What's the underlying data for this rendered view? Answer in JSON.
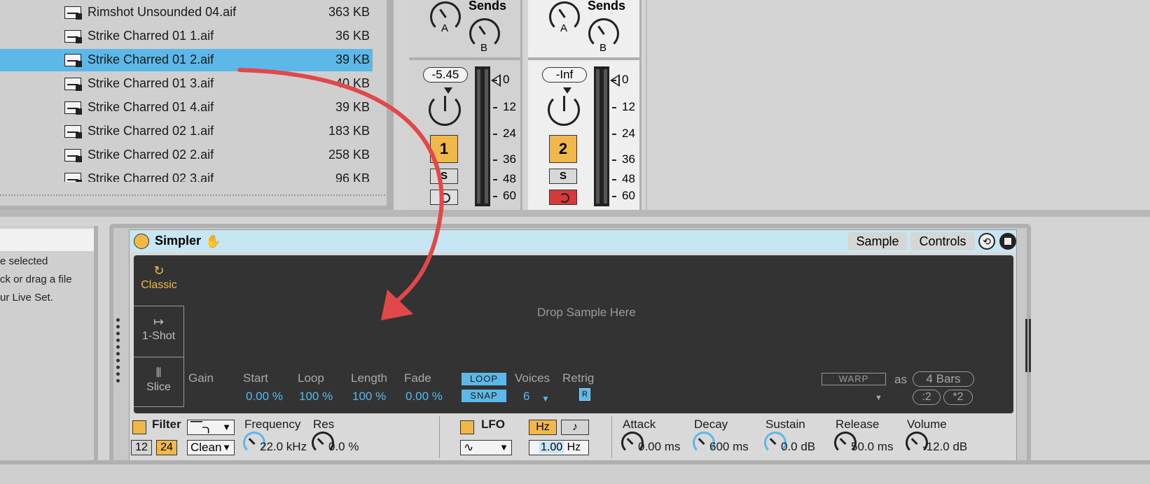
{
  "browser": {
    "files": [
      {
        "name": "Rimshot Unsounded 04.aif",
        "size": "363 KB"
      },
      {
        "name": "Strike Charred 01 1.aif",
        "size": "36 KB"
      },
      {
        "name": "Strike Charred 01 2.aif",
        "size": "39 KB"
      },
      {
        "name": "Strike Charred 01 3.aif",
        "size": "40 KB"
      },
      {
        "name": "Strike Charred 01 4.aif",
        "size": "39 KB"
      },
      {
        "name": "Strike Charred 02 1.aif",
        "size": "183 KB"
      },
      {
        "name": "Strike Charred 02 2.aif",
        "size": "258 KB"
      },
      {
        "name": "Strike Charred 02 3.aif",
        "size": "96 KB"
      }
    ],
    "selected_index": 2
  },
  "mixer": {
    "sends_label": "Sends",
    "send_a": "A",
    "send_b": "B",
    "tracks": [
      {
        "volume": "-5.45",
        "number": "1",
        "solo": "S",
        "armed": false
      },
      {
        "volume": "-Inf",
        "number": "2",
        "solo": "S",
        "armed": true
      }
    ],
    "scale": [
      "0",
      "12",
      "24",
      "36",
      "48",
      "60"
    ]
  },
  "info": {
    "lines": [
      "e selected",
      "ck or drag a file",
      "ur Live Set."
    ]
  },
  "simpler": {
    "title": "Simpler",
    "tab_sample": "Sample",
    "tab_controls": "Controls",
    "modes": [
      {
        "label": "Classic",
        "icon": "loop-arrow-icon"
      },
      {
        "label": "1-Shot",
        "icon": "one-shot-arrow-icon"
      },
      {
        "label": "Slice",
        "icon": "slice-bars-icon"
      }
    ],
    "drop_text": "Drop Sample Here",
    "params": {
      "gain": {
        "label": "Gain"
      },
      "start": {
        "label": "Start",
        "value": "0.00 %"
      },
      "loop": {
        "label": "Loop",
        "value": "100 %"
      },
      "length": {
        "label": "Length",
        "value": "100 %"
      },
      "fade": {
        "label": "Fade",
        "value": "0.00 %"
      },
      "loop_toggle": "LOOP",
      "snap_toggle": "SNAP",
      "voices": {
        "label": "Voices",
        "value": "6"
      },
      "retrig": {
        "label": "Retrig",
        "value": "R"
      }
    },
    "warp": {
      "label": "WARP",
      "as": "as",
      "bars": "4 Bars",
      "half": ":2",
      "double": "*2"
    },
    "filter": {
      "label": "Filter",
      "slope_12": "12",
      "slope_24": "24",
      "circuit": "Clean",
      "frequency_label": "Frequency",
      "frequency_value": "22.0 kHz",
      "res_label": "Res",
      "res_value": "0.0 %"
    },
    "lfo": {
      "label": "LFO",
      "hz_btn": "Hz",
      "note_btn": "♪",
      "rate": "1.00",
      "rate_unit": "Hz"
    },
    "envelope": {
      "attack": {
        "label": "Attack",
        "value": "0.00 ms"
      },
      "decay": {
        "label": "Decay",
        "value": "600 ms"
      },
      "sustain": {
        "label": "Sustain",
        "value": "0.0 dB"
      },
      "release": {
        "label": "Release",
        "value": "50.0 ms"
      },
      "volume": {
        "label": "Volume",
        "value": "-12.0 dB"
      }
    }
  },
  "colors": {
    "accent_blue": "#5cb8e8",
    "accent_orange": "#f0b84a",
    "arrow_red": "#e0484a",
    "arm_red": "#d6393a"
  }
}
